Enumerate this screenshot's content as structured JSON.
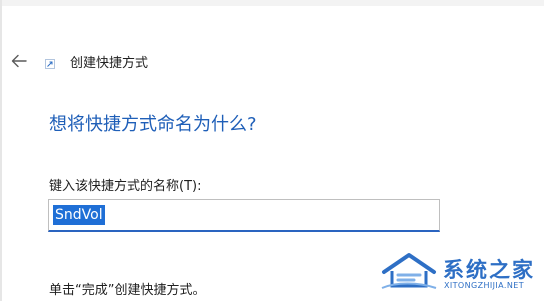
{
  "wizard": {
    "title": "创建快捷方式",
    "icon": "shortcut-wizard-icon",
    "back_icon": "arrow-left-icon"
  },
  "main": {
    "heading": "想将快捷方式命名为什么?",
    "field_label": "键入该快捷方式的名称(T):",
    "name_value": "SndVol",
    "footer_text": "单击“完成”创建快捷方式。"
  },
  "watermark": {
    "name": "系统之家",
    "url": "XITONGZHIJIA.NET",
    "color": "#2e6fc5"
  },
  "colors": {
    "heading": "#1f5fb8",
    "selection": "#1f6fd6",
    "input_underline": "#2a64c0"
  }
}
